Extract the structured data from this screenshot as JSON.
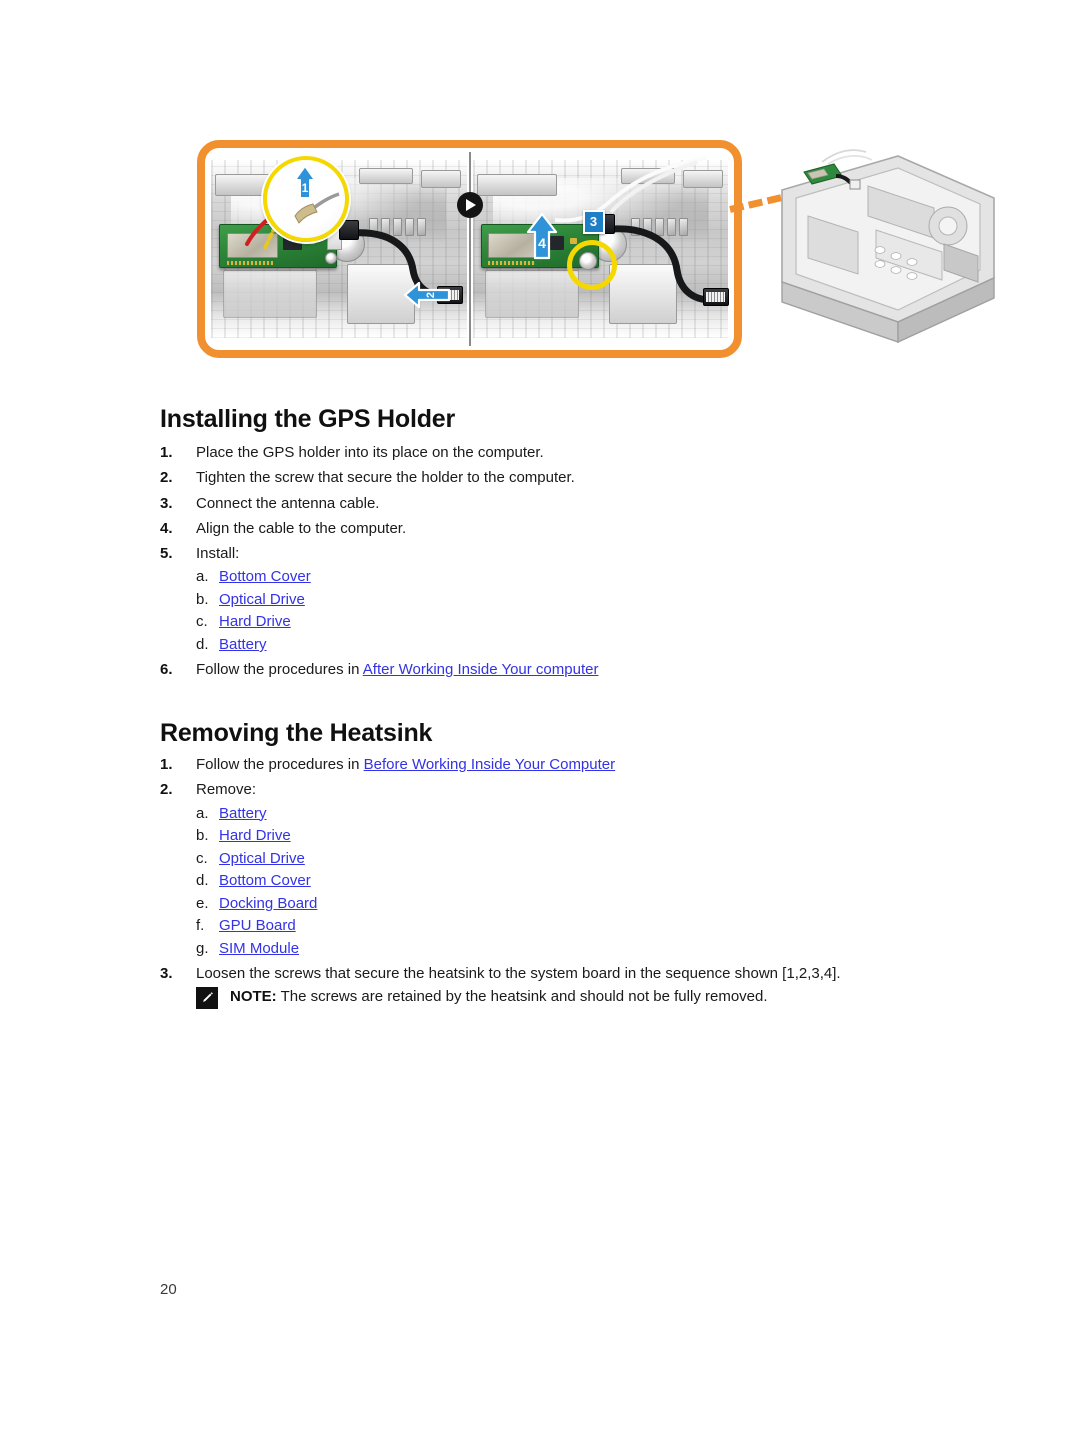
{
  "page": {
    "number": "20"
  },
  "figure": {
    "name": "gps-holder-removal-illustration",
    "frame_color": "#f0902e",
    "divider_icon": "play-icon",
    "panels": [
      {
        "name": "panel-left",
        "callouts": [
          {
            "label": "1",
            "type": "arrow-up",
            "color": "#1f7fc6"
          },
          {
            "label": "2",
            "type": "arrow-left",
            "color": "#1f7fc6"
          }
        ],
        "magnifier": {
          "ring_color": "#f5d800",
          "label": "1"
        }
      },
      {
        "name": "panel-right",
        "callouts": [
          {
            "label": "4",
            "type": "arrow-up",
            "color": "#1f7fc6"
          },
          {
            "label": "3",
            "type": "badge",
            "color": "#1f7fc6"
          }
        ],
        "highlight_ring": {
          "ring_color": "#f5d800"
        }
      }
    ],
    "chassis": {
      "name": "laptop-chassis-3d",
      "leader_color": "#f0902e"
    }
  },
  "sections": [
    {
      "id": "installing-gps-holder",
      "heading": "Installing the GPS Holder",
      "steps": [
        {
          "marker": "1.",
          "text": "Place the GPS holder into its place on the computer."
        },
        {
          "marker": "2.",
          "text": "Tighten the screw that secure the holder to the computer."
        },
        {
          "marker": "3.",
          "text": "Connect the antenna cable."
        },
        {
          "marker": "4.",
          "text": "Align the cable to the computer."
        },
        {
          "marker": "5.",
          "text": "Install:",
          "substeps": [
            {
              "marker": "a.",
              "link": "Bottom Cover"
            },
            {
              "marker": "b.",
              "link": "Optical Drive"
            },
            {
              "marker": "c.",
              "link": "Hard Drive"
            },
            {
              "marker": "d.",
              "link": "Battery"
            }
          ]
        },
        {
          "marker": "6.",
          "text_before": "Follow the procedures in ",
          "link": "After Working Inside Your computer",
          "text_after": ""
        }
      ]
    },
    {
      "id": "removing-heatsink",
      "heading": "Removing the Heatsink",
      "steps": [
        {
          "marker": "1.",
          "text_before": "Follow the procedures in ",
          "link": "Before Working Inside Your Computer",
          "text_after": ""
        },
        {
          "marker": "2.",
          "text": "Remove:",
          "substeps": [
            {
              "marker": "a.",
              "link": "Battery"
            },
            {
              "marker": "b.",
              "link": "Hard Drive"
            },
            {
              "marker": "c.",
              "link": "Optical Drive"
            },
            {
              "marker": "d.",
              "link": "Bottom Cover"
            },
            {
              "marker": "e.",
              "link": "Docking Board"
            },
            {
              "marker": "f.",
              "link": "GPU Board"
            },
            {
              "marker": "g.",
              "link": "SIM Module"
            }
          ]
        },
        {
          "marker": "3.",
          "text": "Loosen the screws that secure the heatsink to the system board in the sequence shown [1,2,3,4]."
        }
      ],
      "note": {
        "icon": "note-pencil-icon",
        "label": "NOTE:",
        "text": " The screws are retained by the heatsink and should not be fully removed."
      }
    }
  ],
  "colors": {
    "link": "#3232e6",
    "heading": "#101010",
    "frame_orange": "#f0902e",
    "callout_blue": "#1f7fc6",
    "highlight_yellow": "#f5d800"
  }
}
